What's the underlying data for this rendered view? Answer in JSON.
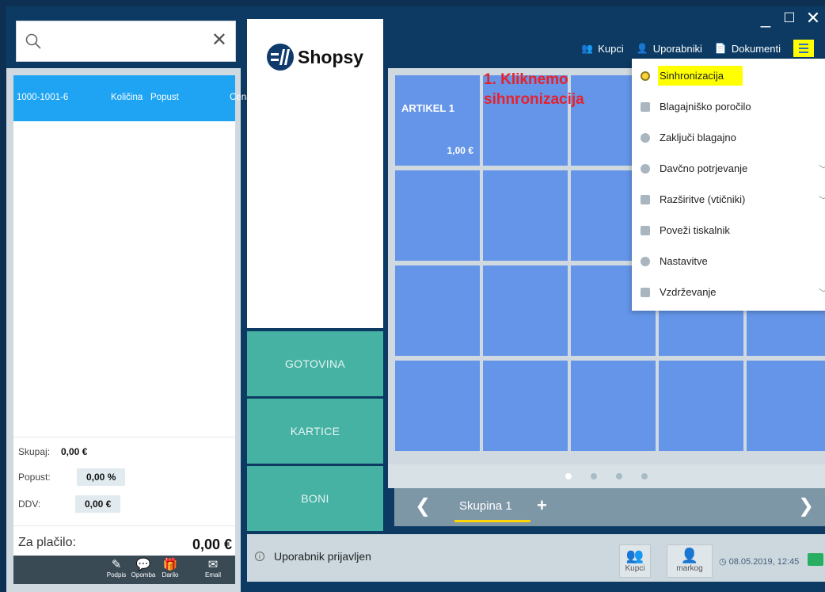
{
  "window": {
    "minimize": "_",
    "maximize": "☐",
    "close": "✕"
  },
  "search": {
    "clear": "✕"
  },
  "brand": {
    "name": "Shopsy"
  },
  "topnav": {
    "customers": "Kupci",
    "users": "Uporabniki",
    "documents": "Dokumenti"
  },
  "menu": {
    "items": [
      {
        "label": "Sinhronizacija",
        "has_submenu": false
      },
      {
        "label": "Blagajniško poročilo",
        "has_submenu": false
      },
      {
        "label": "Zaključi blagajno",
        "has_submenu": false
      },
      {
        "label": "Davčno potrjevanje",
        "has_submenu": true
      },
      {
        "label": "Razširitve (vtičniki)",
        "has_submenu": true
      },
      {
        "label": "Poveži tiskalnik",
        "has_submenu": false
      },
      {
        "label": "Nastavitve",
        "has_submenu": false
      },
      {
        "label": "Vzdrževanje",
        "has_submenu": true
      }
    ]
  },
  "annotation": {
    "line1": "1. Kliknemo",
    "line2": "sihnronizacija"
  },
  "cart": {
    "receipt_code": "1000-1001-6",
    "columns": [
      "Količina",
      "Popust",
      "Cena"
    ],
    "total_label": "Skupaj:",
    "total_value": "0,00 €",
    "discount_label": "Popust:",
    "discount_value": "0,00 %",
    "vat_label": "DDV:",
    "vat_value": "0,00 €",
    "pay_label": "Za plačilo:",
    "pay_value": "0,00 €",
    "tools": [
      "Podpis",
      "Opomba",
      "Darilo",
      "Email"
    ]
  },
  "payment": {
    "cash": "GOTOVINA",
    "cards": "KARTICE",
    "vouchers": "BONI"
  },
  "products": [
    {
      "name": "ARTIKEL 1",
      "price": "1,00 €"
    }
  ],
  "groups": {
    "current": "Skupina 1",
    "prev": "❮",
    "next": "❯",
    "add": "+"
  },
  "status": {
    "message": "Uporabnik prijavljen",
    "customers_btn": "Kupci",
    "user_btn": "markog",
    "datetime": "08.05.2019, 12:45"
  },
  "colors": {
    "accent": "#1ea4f3",
    "tile": "#6495e8",
    "pay": "#45b2a4",
    "highlight": "#ffff00",
    "annotation": "#e8202a"
  }
}
